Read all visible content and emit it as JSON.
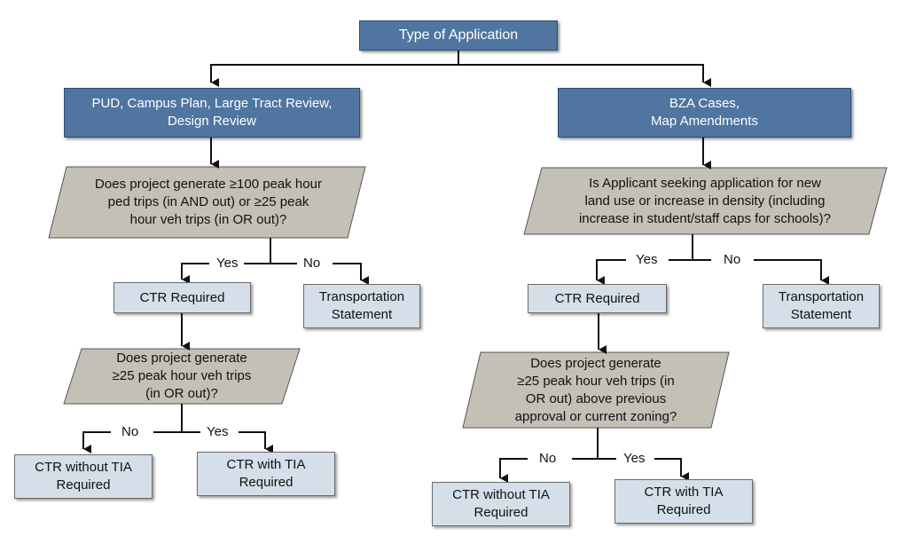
{
  "root": {
    "label": "Type of Application"
  },
  "left": {
    "category": "PUD, Campus Plan, Large Tract Review,\nDesign Review",
    "q1": "Does project generate ≥100 peak hour\nped trips (in AND out) or ≥25 peak\nhour veh trips (in OR out)?",
    "q1_yes": "Yes",
    "q1_no": "No",
    "ctr_required": "CTR Required",
    "transport_statement": "Transportation\nStatement",
    "q2": "Does project generate\n≥25 peak hour veh trips\n(in OR out)?",
    "q2_no": "No",
    "q2_yes": "Yes",
    "ctr_without_tia": "CTR without TIA\nRequired",
    "ctr_with_tia": "CTR with TIA\nRequired"
  },
  "right": {
    "category": "BZA Cases,\nMap Amendments",
    "q1": "Is Applicant seeking application for new\nland use or increase in density (including\nincrease in student/staff caps for schools)?",
    "q1_yes": "Yes",
    "q1_no": "No",
    "ctr_required": "CTR Required",
    "transport_statement": "Transportation\nStatement",
    "q2": "Does project generate\n≥25 peak hour veh trips (in\nOR out) above previous\napproval or current zoning?",
    "q2_no": "No",
    "q2_yes": "Yes",
    "ctr_without_tia": "CTR without TIA\nRequired",
    "ctr_with_tia": "CTR with TIA\nRequired"
  },
  "colors": {
    "header_fill": "#4f75a0",
    "decision_fill": "#c5c0b6",
    "outcome_fill": "#d5dfea",
    "line": "#111111"
  }
}
